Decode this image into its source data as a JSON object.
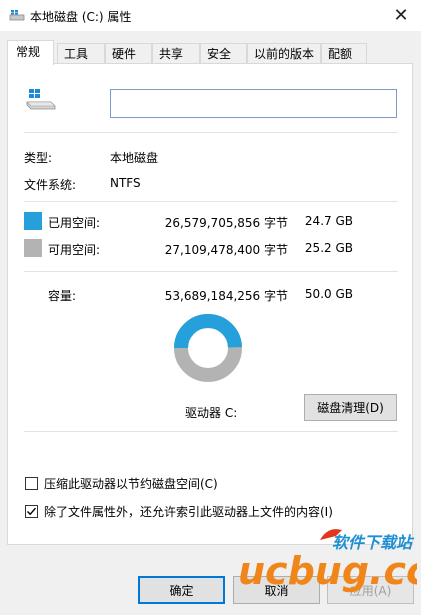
{
  "window": {
    "title": "本地磁盘 (C:) 属性",
    "close_glyph": "✕"
  },
  "tabs": [
    {
      "label": "常规",
      "active": true
    },
    {
      "label": "工具",
      "active": false
    },
    {
      "label": "硬件",
      "active": false
    },
    {
      "label": "共享",
      "active": false
    },
    {
      "label": "安全",
      "active": false
    },
    {
      "label": "以前的版本",
      "active": false
    },
    {
      "label": "配额",
      "active": false
    }
  ],
  "general": {
    "drive_icon": "drive-windows-icon",
    "name_value": "",
    "type_label": "类型:",
    "type_value": "本地磁盘",
    "fs_label": "文件系统:",
    "fs_value": "NTFS"
  },
  "usage": {
    "used": {
      "label": "已用空间:",
      "bytes": "26,579,705,856 字节",
      "size": "24.7 GB",
      "color": "#26a0da"
    },
    "free": {
      "label": "可用空间:",
      "bytes": "27,109,478,400 字节",
      "size": "25.2 GB",
      "color": "#b3b3b3"
    },
    "capacity": {
      "label": "容量:",
      "bytes": "53,689,184,256 字节",
      "size": "50.0 GB"
    },
    "used_fraction": 0.495
  },
  "drive": {
    "label": "驱动器 C:",
    "cleanup_button": "磁盘清理(D)"
  },
  "options": {
    "compress": {
      "label": "压缩此驱动器以节约磁盘空间(C)",
      "checked": false
    },
    "index": {
      "label": "除了文件属性外，还允许索引此驱动器上文件的内容(I)",
      "checked": true
    }
  },
  "buttons": {
    "ok": "确定",
    "cancel": "取消",
    "apply": "应用(A)"
  },
  "watermark": {
    "site_cn": "软件下载站",
    "brand": "ucbug.cc",
    "colors": {
      "orange": "#f08519",
      "blue": "#1f8fd3",
      "red": "#e2371c"
    }
  }
}
